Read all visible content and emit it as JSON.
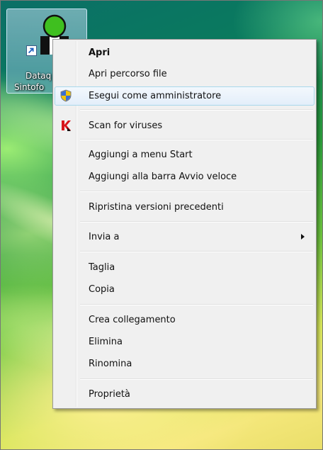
{
  "desktop": {
    "icon": {
      "label_line1": "Dataq",
      "label_line2": "Sintofo",
      "glyph": "app-shortcut-icon"
    }
  },
  "context_menu": {
    "items": [
      {
        "label": "Apri",
        "bold": true
      },
      {
        "label": "Apri percorso file"
      },
      {
        "label": "Esegui come amministratore",
        "icon": "uac-shield-icon",
        "highlighted": true
      },
      {
        "label": "Scan for viruses",
        "icon": "kaspersky-icon"
      },
      {
        "label": "Aggiungi a menu Start"
      },
      {
        "label": "Aggiungi alla barra Avvio veloce"
      },
      {
        "label": "Ripristina versioni precedenti"
      },
      {
        "label": "Invia a",
        "submenu": true
      },
      {
        "label": "Taglia"
      },
      {
        "label": "Copia"
      },
      {
        "label": "Crea collegamento"
      },
      {
        "label": "Elimina"
      },
      {
        "label": "Rinomina"
      },
      {
        "label": "Proprietà"
      }
    ]
  },
  "colors": {
    "menu_background": "#f0f0f0",
    "menu_border": "#979797",
    "highlight_border": "#a8d8eb",
    "kaspersky_red": "#d8151c"
  }
}
